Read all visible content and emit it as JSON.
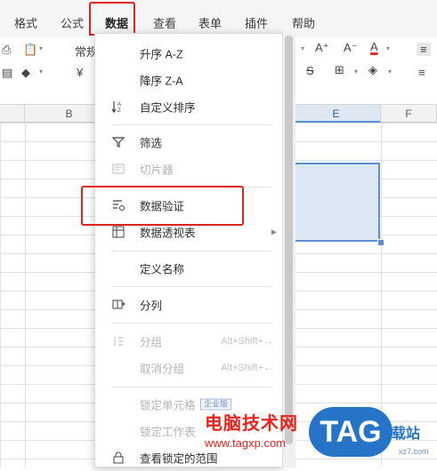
{
  "tabs": [
    "格式",
    "公式",
    "数据",
    "查看",
    "表单",
    "插件",
    "帮助"
  ],
  "ribbon": {
    "number_format": "常规",
    "currency": "¥",
    "font_inc": "A⁺",
    "font_dec": "A⁻",
    "font_color": "A"
  },
  "columns": [
    "B",
    "E",
    "F"
  ],
  "menu": {
    "sort_asc": "升序 A-Z",
    "sort_desc": "降序 Z-A",
    "custom_sort": "自定义排序",
    "filter": "筛选",
    "slicer": "切片器",
    "data_validation": "数据验证",
    "pivot_table": "数据透视表",
    "define_name": "定义名称",
    "split_column": "分列",
    "group": "分组",
    "group_shortcut": "Alt+Shift+→",
    "ungroup": "取消分组",
    "ungroup_shortcut": "Alt+Shift+←",
    "lock_cells": "锁定单元格",
    "enterprise_badge": "企业版",
    "lock_sheet": "锁定工作表",
    "view_locked_range": "查看锁定的范围"
  },
  "watermark": {
    "site_name": "电脑技术网",
    "site_url": "www.tagxp.com",
    "logo": "TAG",
    "logo_suffix": "载站",
    "logo_url": "xz7.com"
  },
  "colors": {
    "accent": "#1f5fa8",
    "highlight_red": "#e0221d",
    "selection": "#dde8f6"
  }
}
